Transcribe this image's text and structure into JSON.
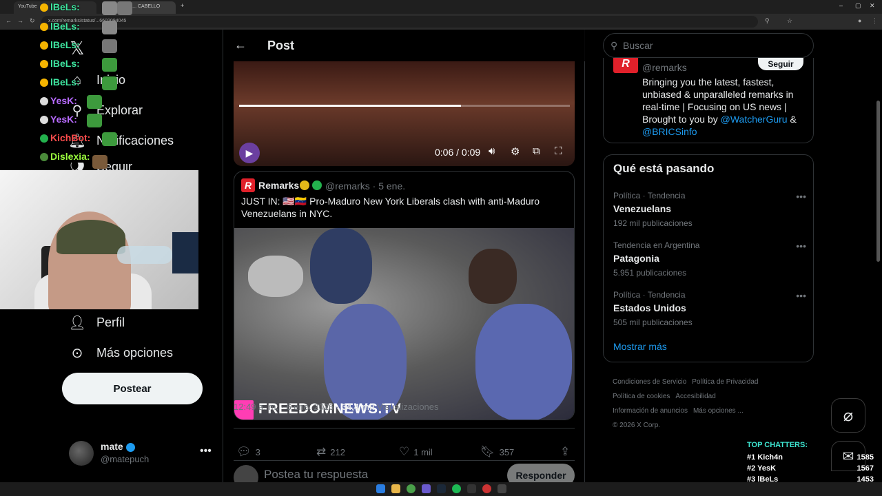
{
  "browser": {
    "tabs": [
      "YouTube",
      "(2) Post de ... CABELLO"
    ],
    "url": "x.com/remarks/status/...6602094045"
  },
  "nav": {
    "items": [
      {
        "id": "home",
        "label": "Inicio",
        "icon": "home-icon"
      },
      {
        "id": "explore",
        "label": "Explorar",
        "icon": "search-icon"
      },
      {
        "id": "notifications",
        "label": "Notificaciones",
        "icon": "bell-icon"
      },
      {
        "id": "follow",
        "label": "Seguir",
        "icon": "people-icon"
      },
      {
        "id": "profile",
        "label": "Perfil",
        "icon": "person-icon"
      },
      {
        "id": "more",
        "label": "Más opciones",
        "icon": "more-circle-icon"
      }
    ],
    "post_button": "Postear",
    "account": {
      "name": "mate",
      "handle": "@matepuch"
    }
  },
  "stream_chat": [
    {
      "user": "lBeLs:",
      "color": "#3ee6a0"
    },
    {
      "user": "lBeLs:",
      "color": "#3ee6a0"
    },
    {
      "user": "lBeLs:",
      "color": "#3ee6a0"
    },
    {
      "user": "lBeLs:",
      "color": "#3ee6a0"
    },
    {
      "user": "lBeLs:",
      "color": "#3ee6a0"
    },
    {
      "user": "YesK:",
      "color": "#b86bff"
    },
    {
      "user": "YesK:",
      "color": "#b86bff"
    },
    {
      "user": "KichBot:",
      "color": "#ff4d4d"
    },
    {
      "user": "Dislexia:",
      "color": "#9cff3e"
    }
  ],
  "header": {
    "title": "Post"
  },
  "video": {
    "time": "0:06 / 0:09",
    "progress": 0.67
  },
  "quoted_post": {
    "name": "Remarks",
    "handle_date": "@remarks · 5 ene.",
    "text": "JUST IN: 🇺🇸🇻🇪 Pro-Maduro New York Liberals clash with anti-Maduro Venezuelans in NYC.",
    "media_watermark": "FREEDOMNEWS.TV"
  },
  "meta": {
    "time": "12:49 a. m. · 6 ene. 2026 · ",
    "views_count": "34,4 mil",
    "views_label": " Visualizaciones"
  },
  "actions": {
    "replies": "3",
    "reposts": "212",
    "likes": "1 mil",
    "bookmarks": "357"
  },
  "reply": {
    "placeholder": "Postea tu respuesta",
    "button": "Responder"
  },
  "search": {
    "placeholder": "Buscar"
  },
  "profile_card": {
    "handle": "@remarks",
    "follow": "Seguir",
    "bio": "Bringing you the latest, fastest, unbiased & unparalleled remarks in real-time | Focusing on US news | Brought to you by ",
    "link1": "@WatcherGuru",
    "amp": " & ",
    "link2": "@BRICSinfo"
  },
  "trends": {
    "title": "Qué está pasando",
    "items": [
      {
        "context": "Política · Tendencia",
        "name": "Venezuelans",
        "count": "192 mil publicaciones"
      },
      {
        "context": "Tendencia en Argentina",
        "name": "Patagonia",
        "count": "5.951 publicaciones"
      },
      {
        "context": "Política · Tendencia",
        "name": "Estados Unidos",
        "count": "505 mil publicaciones"
      }
    ],
    "show_more": "Mostrar más"
  },
  "footer": {
    "links": [
      "Condiciones de Servicio",
      "Política de Privacidad",
      "Política de cookies",
      "Accesibilidad",
      "Información de anuncios",
      "Más opciones ..."
    ],
    "copyright": "© 2026 X Corp."
  },
  "top_chatters": {
    "title": "TOP CHATTERS:",
    "rows": [
      {
        "rank": "#1",
        "name": "Kich4n",
        "count": "1585"
      },
      {
        "rank": "#2",
        "name": "YesK",
        "count": "1567"
      },
      {
        "rank": "#3",
        "name": "lBeLs",
        "count": "1453"
      }
    ]
  }
}
